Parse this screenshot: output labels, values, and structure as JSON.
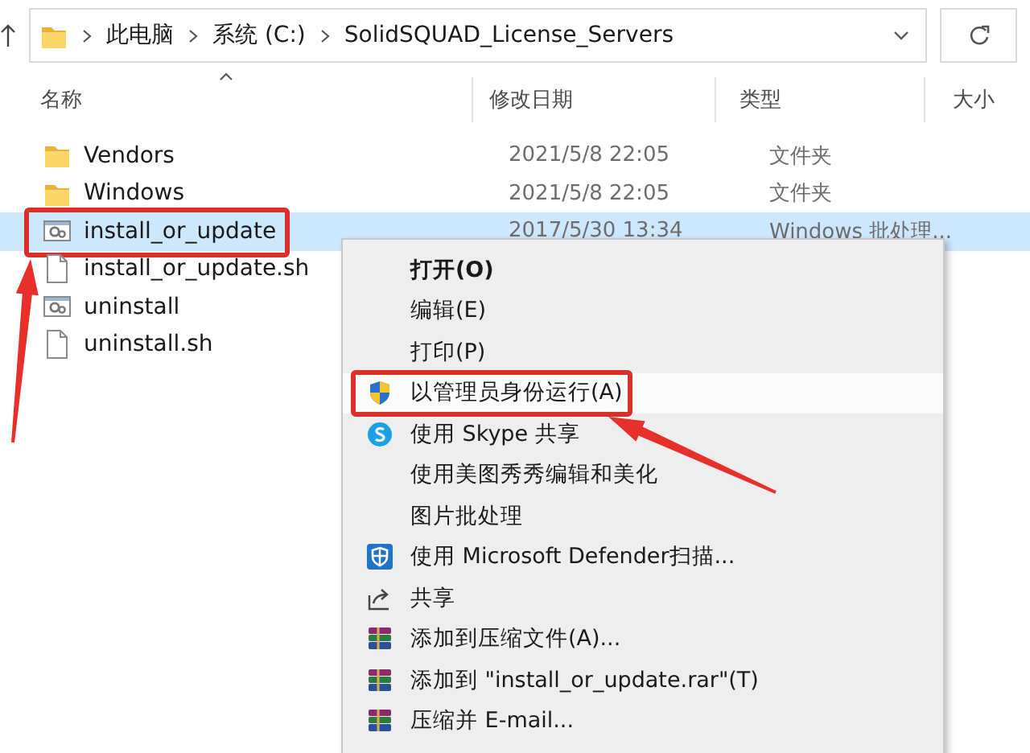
{
  "address_bar": {
    "path": [
      "此电脑",
      "系统 (C:)",
      "SolidSQUAD_License_Servers"
    ]
  },
  "columns": [
    {
      "label": "名称",
      "sorted": true
    },
    {
      "label": "修改日期",
      "sorted": false
    },
    {
      "label": "类型",
      "sorted": false
    },
    {
      "label": "大小",
      "sorted": false
    }
  ],
  "files": [
    {
      "name": "Vendors",
      "kind": "folder",
      "modified": "2021/5/8 22:05",
      "type": "文件夹",
      "selected": false,
      "annotated": false
    },
    {
      "name": "Windows",
      "kind": "folder",
      "modified": "2021/5/8 22:05",
      "type": "文件夹",
      "selected": false,
      "annotated": false
    },
    {
      "name": "install_or_update",
      "kind": "batch",
      "modified": "2017/5/30 13:34",
      "type": "Windows 批处理...",
      "selected": true,
      "annotated": true
    },
    {
      "name": "install_or_update.sh",
      "kind": "script",
      "selected": false,
      "annotated": false
    },
    {
      "name": "uninstall",
      "kind": "batch",
      "selected": false,
      "annotated": false
    },
    {
      "name": "uninstall.sh",
      "kind": "script",
      "selected": false,
      "annotated": false
    }
  ],
  "context_menu": {
    "items": [
      {
        "label": "打开(O)",
        "kind": "plain",
        "bold": true,
        "selected": false,
        "annotated": false
      },
      {
        "label": "编辑(E)",
        "kind": "plain",
        "bold": false,
        "selected": false,
        "annotated": false
      },
      {
        "label": "打印(P)",
        "kind": "plain",
        "bold": false,
        "selected": false,
        "annotated": false
      },
      {
        "label": "以管理员身份运行(A)",
        "kind": "shield",
        "bold": false,
        "selected": true,
        "annotated": true
      },
      {
        "label": "使用 Skype 共享",
        "kind": "skype",
        "bold": false,
        "selected": false,
        "annotated": false
      },
      {
        "label": "使用美图秀秀编辑和美化",
        "kind": "plain",
        "bold": false,
        "selected": false,
        "annotated": false
      },
      {
        "label": "图片批处理",
        "kind": "plain",
        "bold": false,
        "selected": false,
        "annotated": false
      },
      {
        "label": "使用 Microsoft Defender扫描...",
        "kind": "defender",
        "bold": false,
        "selected": false,
        "annotated": false
      },
      {
        "label": "共享",
        "kind": "share",
        "bold": false,
        "selected": false,
        "annotated": false
      },
      {
        "label": "添加到压缩文件(A)...",
        "kind": "rar",
        "bold": false,
        "selected": false,
        "annotated": false
      },
      {
        "label": "添加到 \"install_or_update.rar\"(T)",
        "kind": "rar",
        "bold": false,
        "selected": false,
        "annotated": false
      },
      {
        "label": "压缩并 E-mail...",
        "kind": "rar",
        "bold": false,
        "selected": false,
        "annotated": false
      }
    ]
  }
}
